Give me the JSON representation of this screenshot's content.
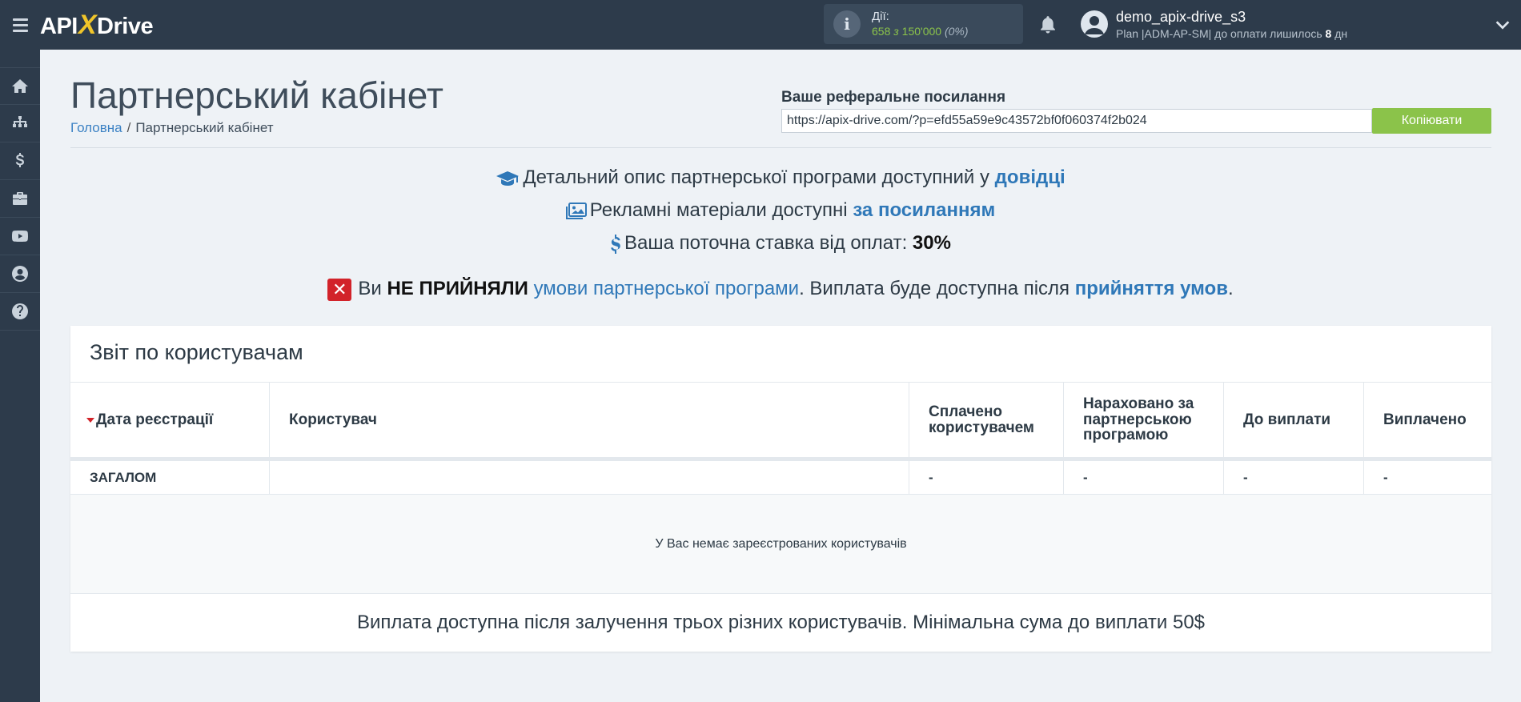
{
  "app": {
    "logo_left": "API",
    "logo_x": "X",
    "logo_right": "Drive"
  },
  "header": {
    "actions_title": "Дії:",
    "actions_used": "658",
    "actions_of": "з",
    "actions_total": "150'000",
    "actions_pct": "(0%)",
    "user_name": "demo_apix-drive_s3",
    "plan_text": "Plan |ADM-AP-SM| до оплати лишилось",
    "plan_days": "8",
    "plan_days_unit": "дн"
  },
  "sidebar": {
    "items": [
      {
        "icon": "home-icon"
      },
      {
        "icon": "sitemap-icon"
      },
      {
        "icon": "dollar-icon"
      },
      {
        "icon": "briefcase-icon"
      },
      {
        "icon": "youtube-icon"
      },
      {
        "icon": "user-circle-icon"
      },
      {
        "icon": "help-icon"
      }
    ]
  },
  "page": {
    "title": "Партнерський кабінет",
    "breadcrumb_home": "Головна",
    "breadcrumb_sep": "/",
    "breadcrumb_current": "Партнерський кабінет"
  },
  "referral": {
    "label": "Ваше реферальне посилання",
    "url": "https://apix-drive.com/?p=efd55a59e9c43572bf0f060374f2b024",
    "copy_label": "Копіювати"
  },
  "info": {
    "line1_text": "Детальний опис партнерської програми доступний у",
    "line1_link": "довідці",
    "line2_text": "Рекламні матеріали доступні",
    "line2_link": "за посиланням",
    "line3_text": "Ваша поточна ставка від оплат:",
    "line3_rate": "30%",
    "line4_prefix": "Ви",
    "line4_not": "НЕ ПРИЙНЯЛИ",
    "line4_link1": "умови партнерської програми",
    "line4_mid": ". Виплата буде доступна після",
    "line4_link2": "прийняття умов",
    "line4_end": "."
  },
  "report": {
    "title": "Звіт по користувачам",
    "columns": [
      "Дата реєстрації",
      "Користувач",
      "Сплачено користувачем",
      "Нараховано за партнерською програмою",
      "До виплати",
      "Виплачено"
    ],
    "total_row": [
      "ЗАГАЛОМ",
      "",
      "-",
      "-",
      "-",
      "-"
    ],
    "empty_message": "У Вас немає зареєстрованих користувачів",
    "footer": "Виплата доступна після залучення трьох різних користувачів. Мінімальна сума до виплати 50$"
  },
  "colors": {
    "topbar": "#2d3b4b",
    "accent_green": "#8bc34a",
    "link_blue": "#2f78b8",
    "logo_yellow": "#f0c52a",
    "error_red": "#d2232a"
  }
}
